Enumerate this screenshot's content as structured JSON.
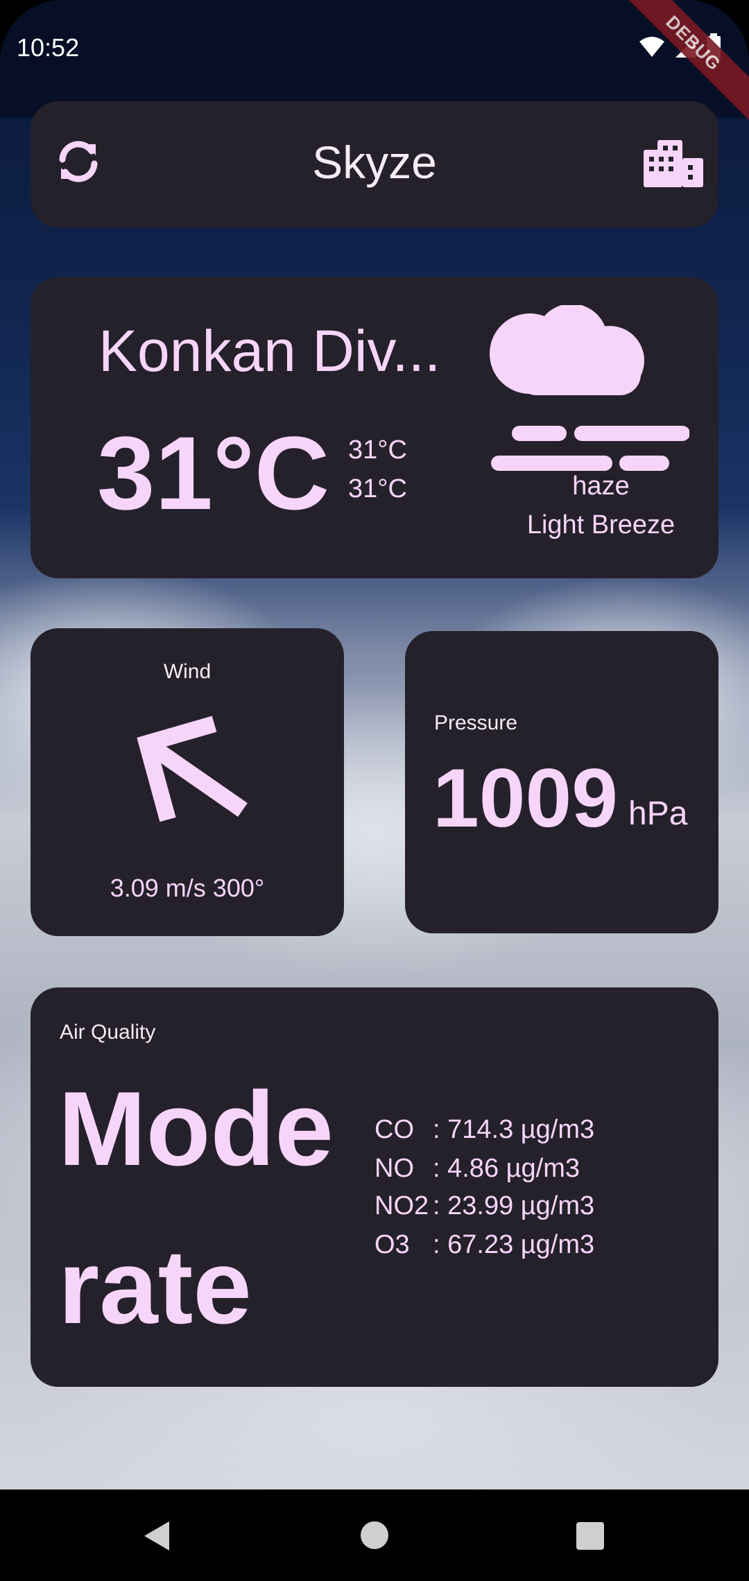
{
  "status_bar": {
    "time": "10:52",
    "debug_label": "DEBUG"
  },
  "header": {
    "title": "Skyze",
    "refresh_icon": "refresh-icon",
    "city_icon": "city-buildings-icon"
  },
  "current_weather": {
    "city": "Konkan Div...",
    "temperature": "31°C",
    "temp_max": "31°C",
    "temp_min": "31°C",
    "condition_icon": "haze-fog-icon",
    "condition": "haze",
    "wind_description": "Light Breeze"
  },
  "wind": {
    "label": "Wind",
    "direction_icon": "wind-direction-arrow-icon",
    "direction_degrees": 300,
    "value": "3.09 m/s 300°"
  },
  "pressure": {
    "label": "Pressure",
    "value": "1009",
    "unit": "hPa"
  },
  "air_quality": {
    "label": "Air Quality",
    "status_line1": "Mode",
    "status_line2": "rate",
    "pollutants": [
      {
        "symbol": "CO",
        "value": ": 714.3 µg/m3"
      },
      {
        "symbol": "NO",
        "value": ": 4.86 µg/m3"
      },
      {
        "symbol": "NO2",
        "value": ": 23.99 µg/m3"
      },
      {
        "symbol": "O3",
        "value": ": 67.23 µg/m3"
      }
    ]
  },
  "colors": {
    "accent": "#f7d5fb",
    "card_background": "#25212a"
  }
}
